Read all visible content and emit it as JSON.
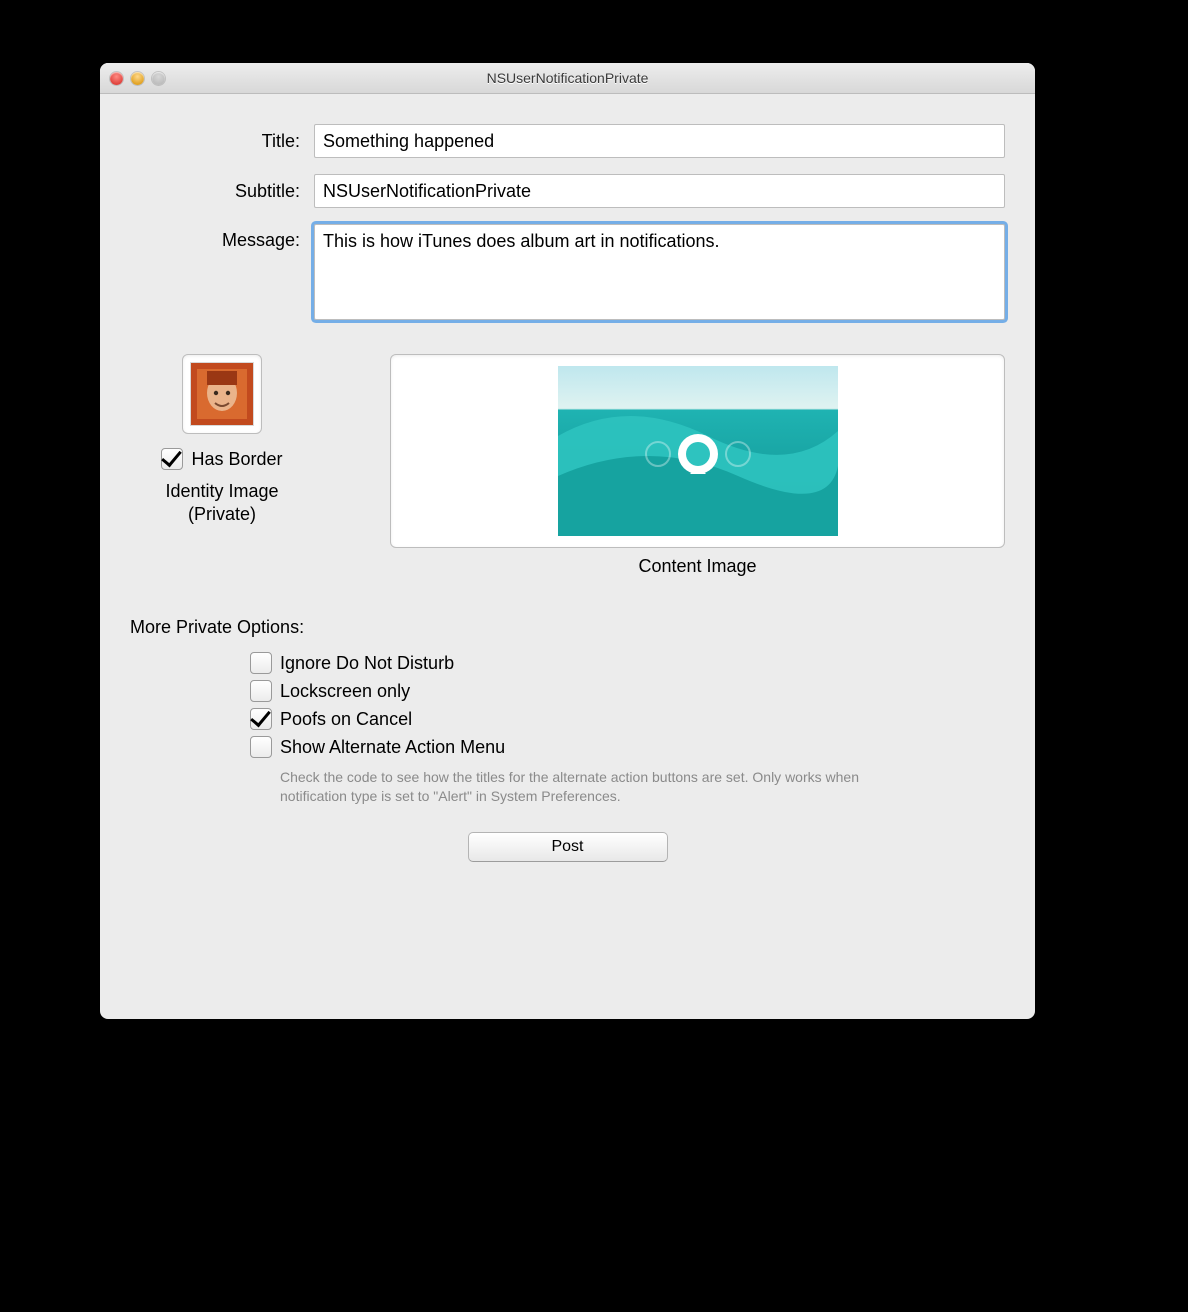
{
  "window": {
    "title": "NSUserNotificationPrivate"
  },
  "form": {
    "title_label": "Title:",
    "title_value": "Something happened",
    "subtitle_label": "Subtitle:",
    "subtitle_value": "NSUserNotificationPrivate",
    "message_label": "Message:",
    "message_value": "This is how iTunes does album art in notifications."
  },
  "identity": {
    "has_border_label": "Has Border",
    "has_border_checked": true,
    "caption_l1": "Identity Image",
    "caption_l2": "(Private)"
  },
  "content_image_caption": "Content Image",
  "more_options_header": "More Private Options:",
  "options": {
    "ignore_dnd": {
      "label": "Ignore Do Not Disturb",
      "checked": false
    },
    "lockscreen_only": {
      "label": "Lockscreen only",
      "checked": false
    },
    "poofs_on_cancel": {
      "label": "Poofs on Cancel",
      "checked": true
    },
    "show_alt_menu": {
      "label": "Show Alternate Action Menu",
      "checked": false
    }
  },
  "hint": "Check the code to see how the titles for the alternate action buttons are set. Only works when notification type is set to \"Alert\" in System Preferences.",
  "post_button": "Post"
}
